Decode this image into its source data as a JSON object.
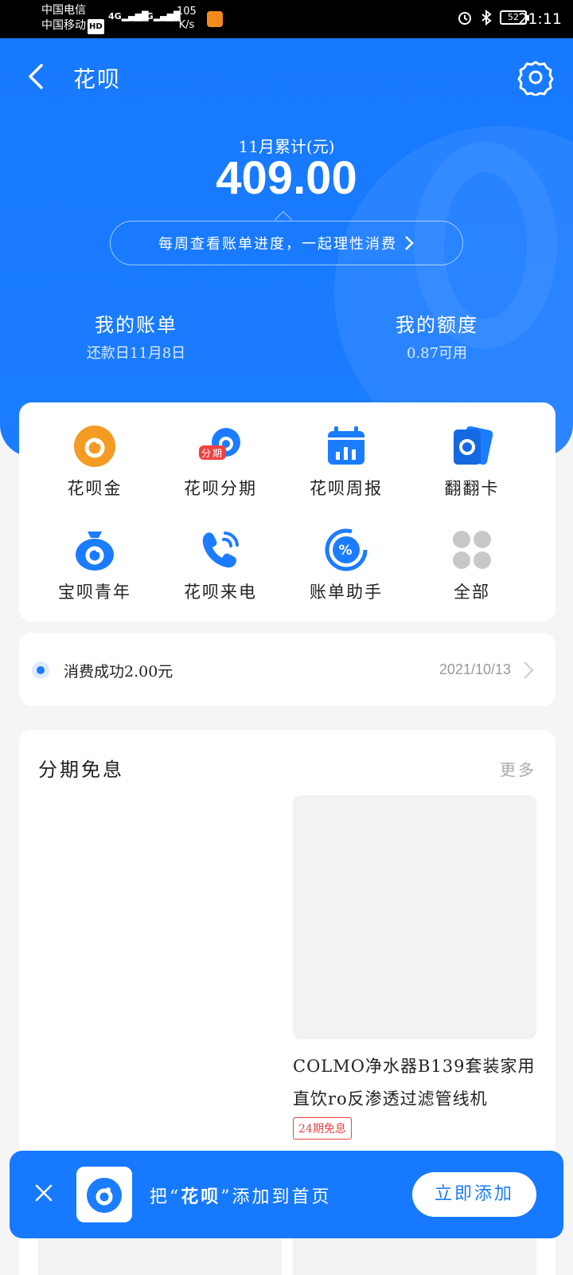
{
  "status_bar": {
    "carrier1": "中国电信",
    "carrier2": "中国移动",
    "hd": "HD",
    "net1": "4G",
    "net2": "4G",
    "speed_value": "105",
    "speed_unit": "K/s",
    "battery": "52",
    "time": "21:11"
  },
  "header": {
    "title": "花呗"
  },
  "summary": {
    "month_label": "11月累计(元)",
    "amount": "409.00",
    "weekly_prompt": "每周查看账单进度，一起理性消费"
  },
  "bill": {
    "label": "我的账单",
    "due": "还款日11月8日"
  },
  "quota": {
    "label": "我的额度",
    "value": "0.87可用"
  },
  "services": [
    {
      "label": "花呗金",
      "icon": "huabei-gold-icon"
    },
    {
      "label": "花呗分期",
      "icon": "installment-icon",
      "badge": "分期"
    },
    {
      "label": "花呗周报",
      "icon": "calendar-report-icon"
    },
    {
      "label": "翻翻卡",
      "icon": "flip-card-icon"
    },
    {
      "label": "宝呗青年",
      "icon": "money-bag-icon"
    },
    {
      "label": "花呗来电",
      "icon": "phone-call-icon"
    },
    {
      "label": "账单助手",
      "icon": "percent-icon"
    },
    {
      "label": "全部",
      "icon": "all-grid-icon"
    }
  ],
  "notice": {
    "text": "消费成功2.00元",
    "date": "2021/10/13"
  },
  "promo": {
    "title": "分期免息",
    "more": "更多",
    "product_name": "COLMO净水器B139套装家用直饮ro反渗透过滤管线机",
    "product_tag": "24期免息"
  },
  "banner": {
    "text_prefix": "把“",
    "text_highlight": "花呗",
    "text_suffix": "”添加到首页",
    "button": "立即添加"
  },
  "colors": {
    "brand_blue": "#1779ff",
    "accent_orange": "#f59a23",
    "tag_red": "#e84545"
  }
}
